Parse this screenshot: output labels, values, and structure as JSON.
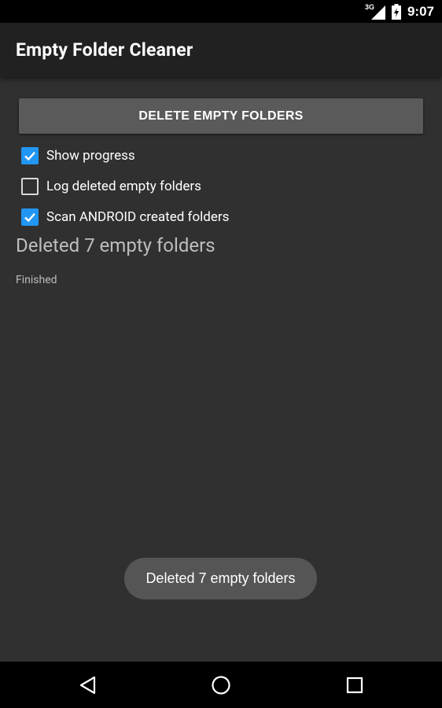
{
  "status_bar": {
    "network": "3G",
    "time": "9:07"
  },
  "app_bar": {
    "title": "Empty Folder Cleaner"
  },
  "actions": {
    "delete_label": "DELETE EMPTY FOLDERS"
  },
  "options": [
    {
      "label": "Show progress",
      "checked": true
    },
    {
      "label": "Log deleted empty folders",
      "checked": false
    },
    {
      "label": "Scan ANDROID created folders",
      "checked": true
    }
  ],
  "result": {
    "message": "Deleted 7 empty folders",
    "status": "Finished"
  },
  "toast": {
    "message": "Deleted 7 empty folders"
  },
  "colors": {
    "background": "#303030",
    "app_bar": "#212121",
    "checkbox_accent": "#2196f3",
    "button": "#5a5a5a"
  },
  "icons": {
    "signal": "cell-signal-icon",
    "battery": "battery-charging-icon",
    "back": "back-icon",
    "home": "home-icon",
    "recents": "recents-icon"
  }
}
